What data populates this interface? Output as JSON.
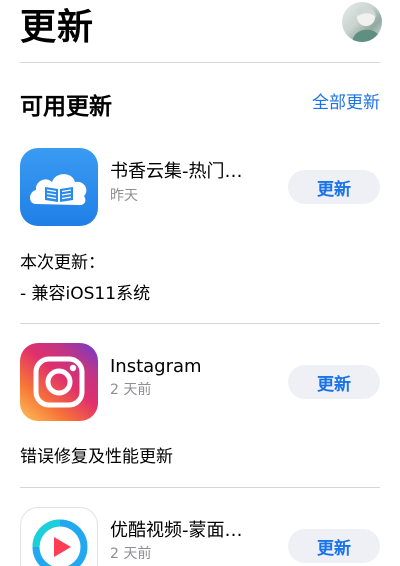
{
  "header": {
    "title": "更新"
  },
  "section": {
    "title": "可用更新",
    "update_all_label": "全部更新"
  },
  "apps": [
    {
      "name": "书香云集-热门…",
      "date": "昨天",
      "button_label": "更新",
      "icon": "book-cloud-icon",
      "notes_heading": "本次更新：",
      "notes_line": "- 兼容iOS11系统"
    },
    {
      "name": "Instagram",
      "date": "2 天前",
      "button_label": "更新",
      "icon": "camera-icon",
      "notes_line": "错误修复及性能更新"
    },
    {
      "name": "优酷视频-蒙面…",
      "date": "2 天前",
      "button_label": "更新",
      "icon": "play-icon"
    }
  ],
  "colors": {
    "accent": "#1a73e8",
    "button_bg": "#eef0f5",
    "secondary_text": "#8e8e93"
  }
}
